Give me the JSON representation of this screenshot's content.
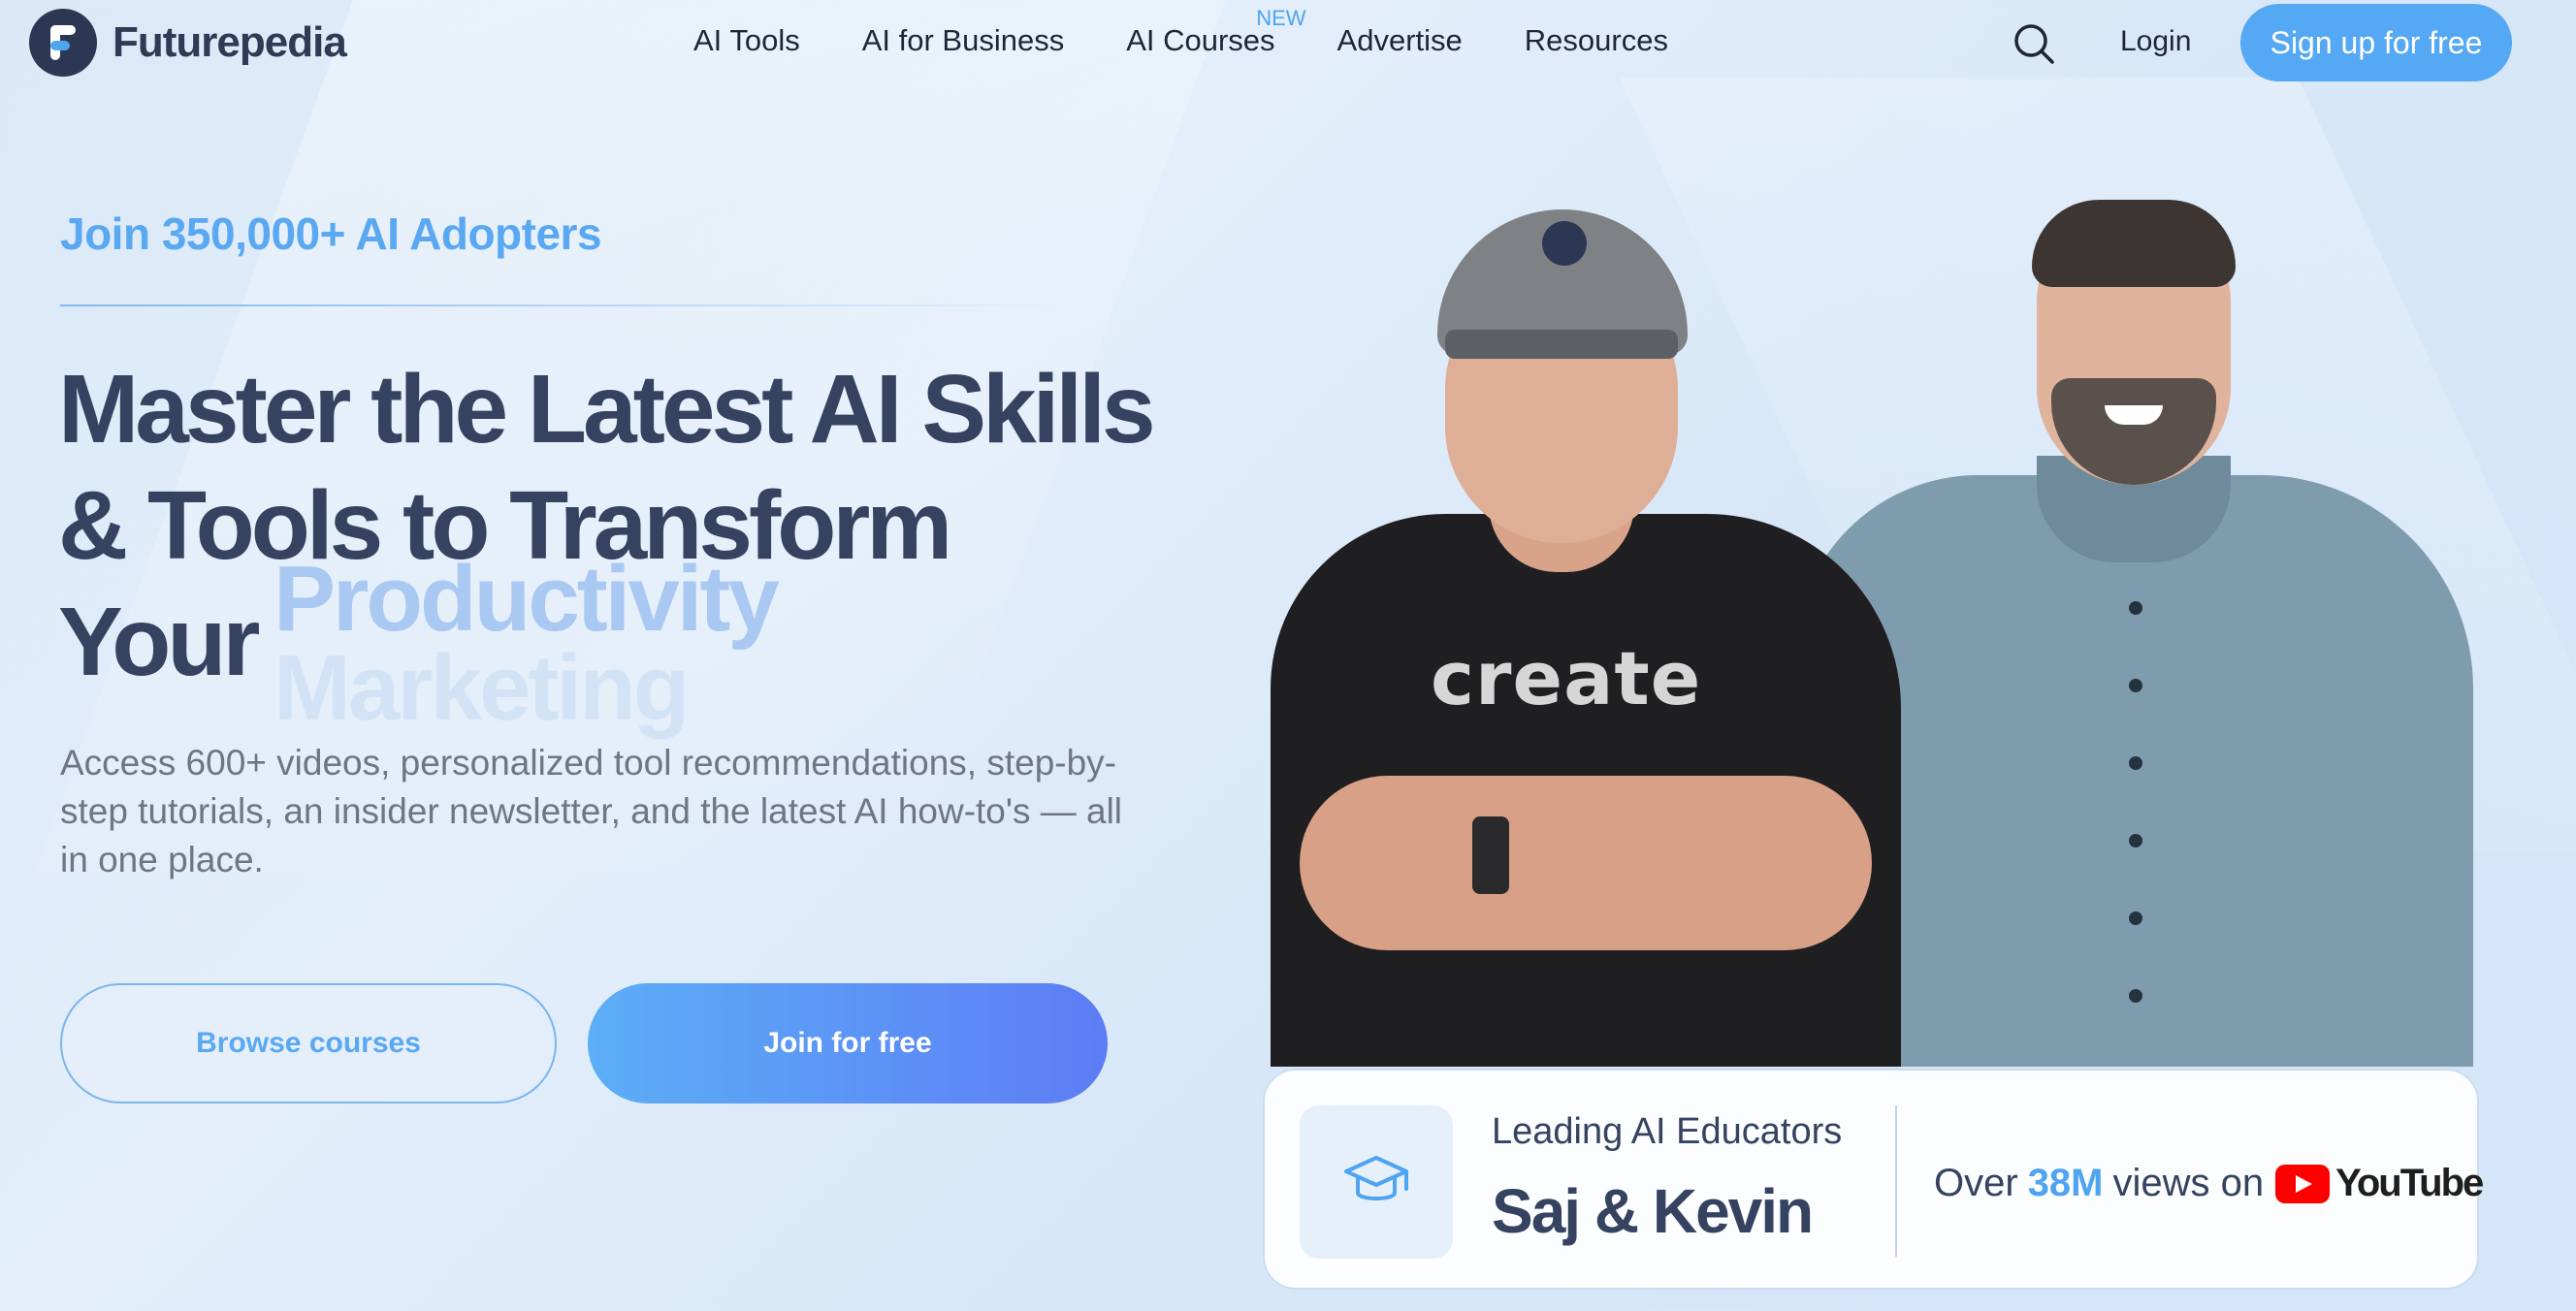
{
  "nav": {
    "brand": "Futurepedia",
    "links": [
      "AI Tools",
      "AI for Business",
      "AI Courses",
      "Advertise",
      "Resources"
    ],
    "courses_badge": "NEW",
    "login": "Login",
    "signup": "Sign up for free",
    "search_icon": "search-icon"
  },
  "hero": {
    "eyebrow": "Join 350,000+ AI Adopters",
    "headline_line1": "Master the Latest AI Skills",
    "headline_line2": "& Tools to Transform",
    "headline_line3": "Your",
    "rotating_words": [
      "Productivity",
      "Marketing"
    ],
    "description": "Access 600+ videos, personalized tool recommendations, step-by-step tutorials, an insider newsletter, and the latest AI how-to's — all in one place.",
    "browse_button": "Browse courses",
    "join_button": "Join for free",
    "shirt_text": "create"
  },
  "card": {
    "icon": "graduation-cap-icon",
    "subtitle": "Leading AI Educators",
    "names": "Saj & Kevin",
    "stat_prefix": "Over",
    "stat_value": "38M",
    "stat_suffix": "views on",
    "platform": "YouTube"
  },
  "colors": {
    "accent": "#55a8f3",
    "heading": "#364360",
    "gradient_end": "#5d7cf5"
  }
}
